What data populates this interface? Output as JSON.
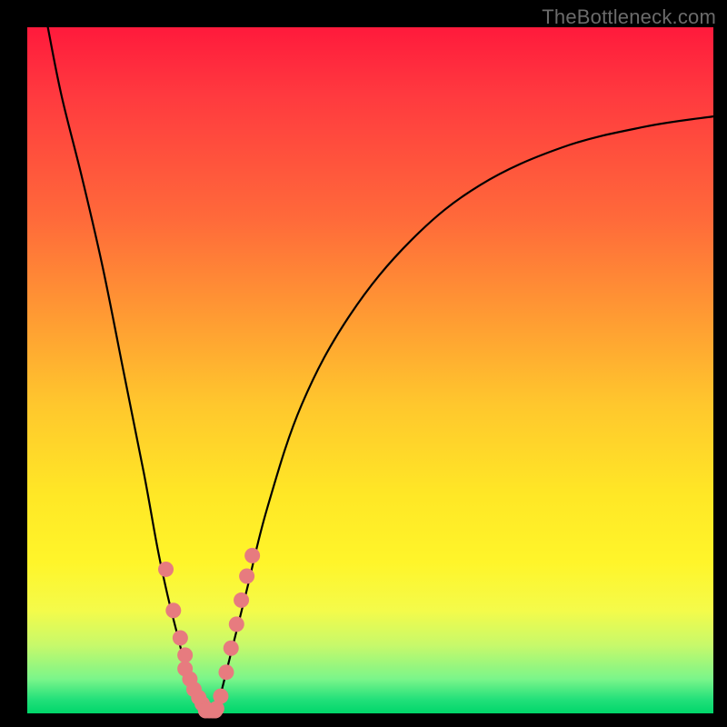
{
  "watermark": "TheBottleneck.com",
  "chart_data": {
    "type": "line",
    "title": "",
    "xlabel": "",
    "ylabel": "",
    "xlim": [
      0,
      100
    ],
    "ylim": [
      0,
      100
    ],
    "grid": false,
    "legend": false,
    "series": [
      {
        "name": "left-arm",
        "x": [
          3,
          5,
          8,
          11,
          14,
          17,
          19,
          20.5,
          22,
          23,
          24,
          25,
          25.8
        ],
        "y": [
          100,
          90,
          78,
          65,
          50,
          35,
          24,
          17,
          11,
          7,
          4,
          2,
          0.4
        ],
        "color": "#000000"
      },
      {
        "name": "right-arm",
        "x": [
          27.5,
          28.5,
          30,
          32,
          35,
          40,
          47,
          56,
          66,
          78,
          90,
          100
        ],
        "y": [
          0.4,
          4,
          10,
          18,
          30,
          45,
          58,
          69,
          77,
          82.5,
          85.5,
          87
        ],
        "color": "#000000"
      },
      {
        "name": "left-markers",
        "type_hint": "scatter",
        "x": [
          20.2,
          21.3,
          22.3,
          23.0,
          23.0,
          23.7,
          24.3,
          25.0,
          25.5,
          26.0
        ],
        "y": [
          21.0,
          15.0,
          11.0,
          8.5,
          6.5,
          5.0,
          3.5,
          2.3,
          1.4,
          0.7
        ],
        "color": "#e77b7f"
      },
      {
        "name": "right-markers",
        "type_hint": "scatter",
        "x": [
          27.6,
          28.2,
          29.0,
          29.7,
          30.5,
          31.2,
          32.0,
          32.8
        ],
        "y": [
          0.7,
          2.5,
          6.0,
          9.5,
          13.0,
          16.5,
          20.0,
          23.0
        ],
        "color": "#e77b7f"
      },
      {
        "name": "valley-markers",
        "type_hint": "scatter",
        "x": [
          26.0,
          26.5,
          27.0,
          27.4
        ],
        "y": [
          0.4,
          0.4,
          0.4,
          0.4
        ],
        "color": "#e77b7f"
      }
    ]
  }
}
